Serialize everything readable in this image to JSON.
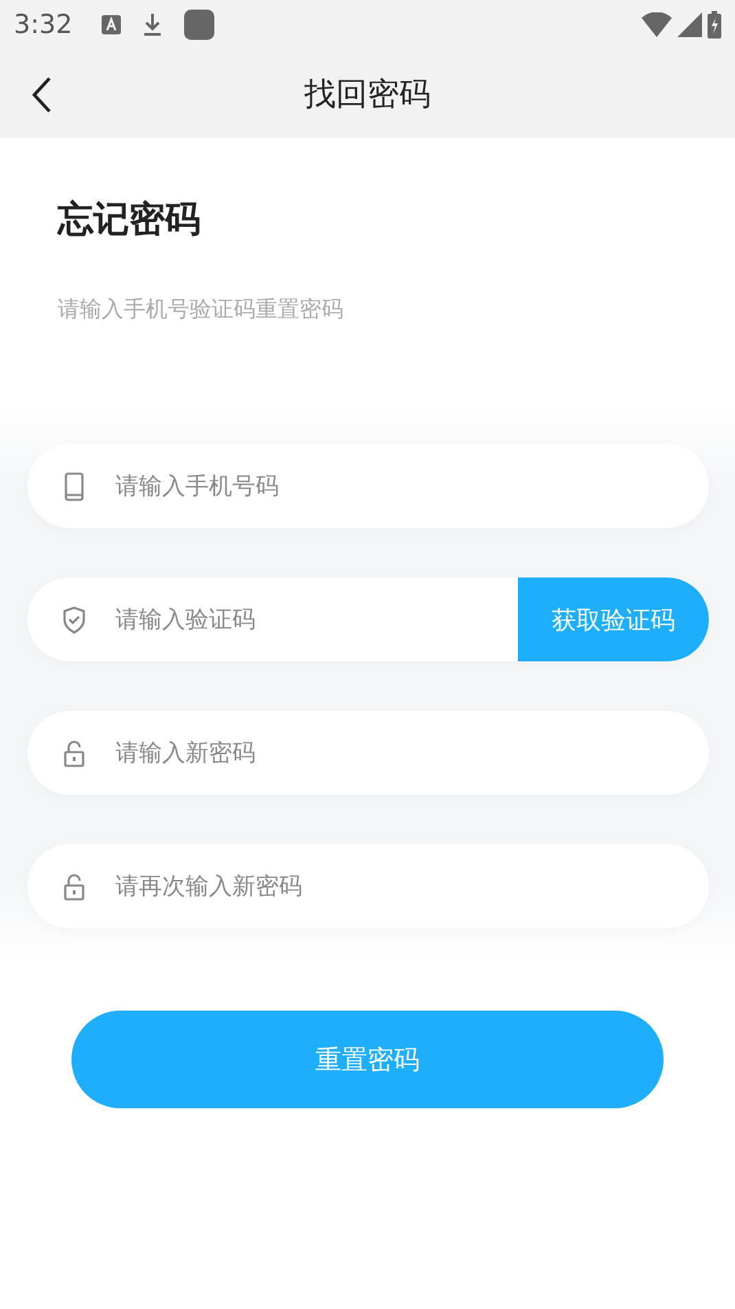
{
  "status_bar": {
    "time": "3:32"
  },
  "header": {
    "title": "找回密码"
  },
  "heading": "忘记密码",
  "subtitle": "请输入手机号验证码重置密码",
  "fields": [
    {
      "kind": "phone",
      "placeholder": "请输入手机号码"
    },
    {
      "kind": "code",
      "placeholder": "请输入验证码",
      "button": "获取验证码"
    },
    {
      "kind": "lock",
      "placeholder": "请输入新密码"
    },
    {
      "kind": "lock",
      "placeholder": "请再次输入新密码"
    }
  ],
  "submit": "重置密码"
}
